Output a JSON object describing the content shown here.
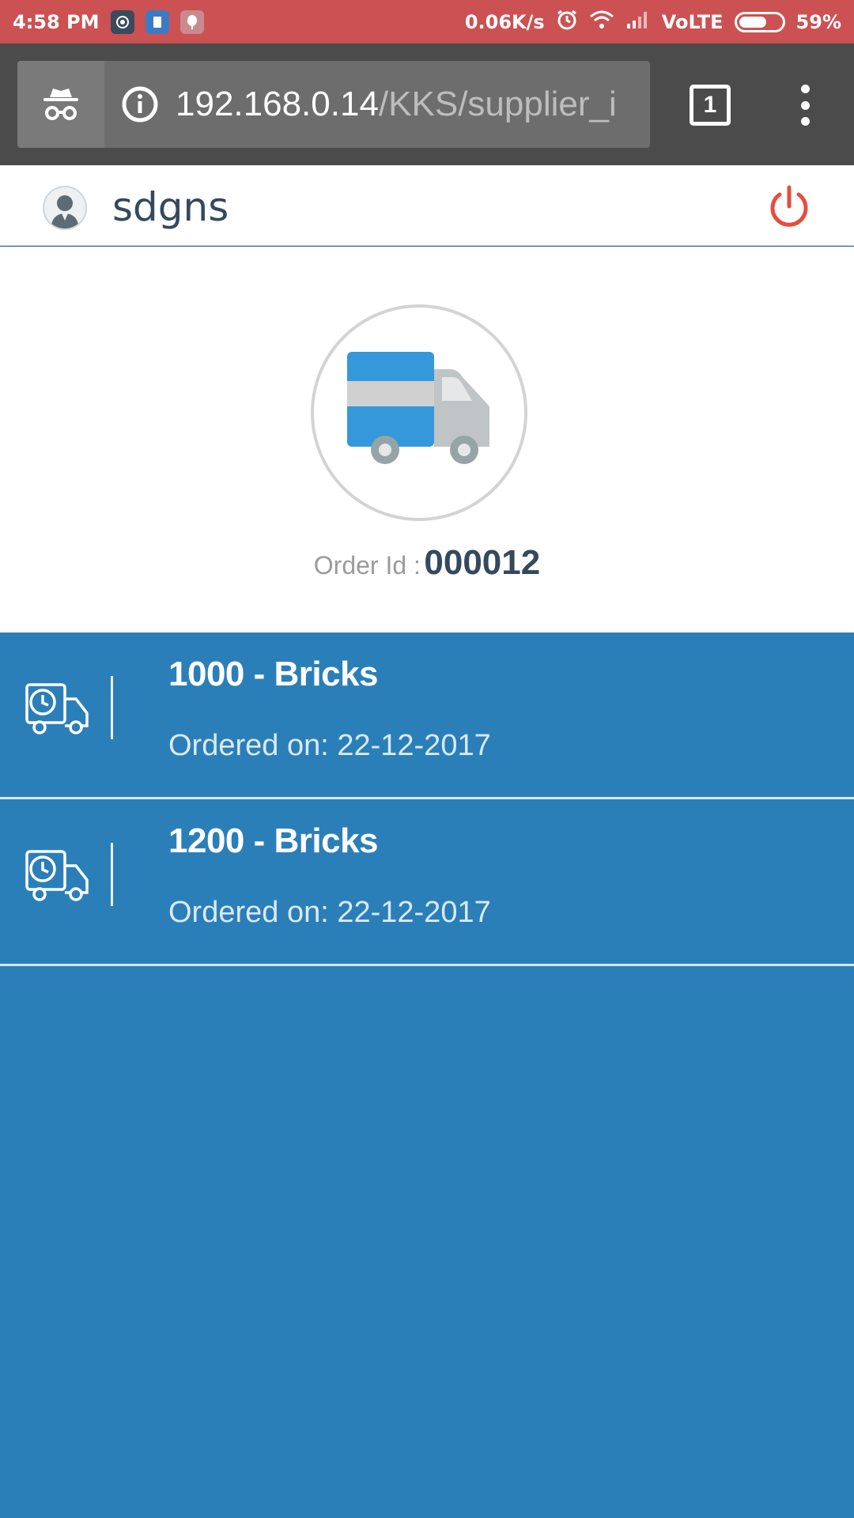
{
  "status_bar": {
    "time": "4:58 PM",
    "net_speed": "0.06K/s",
    "network": "VoLTE",
    "battery": "59%",
    "battery_level": 0.59,
    "icons": [
      "chrome-notification-icon",
      "app-notification-icon",
      "balloon-notification-icon",
      "alarm-icon",
      "wifi-icon",
      "signal-icon",
      "battery-icon"
    ]
  },
  "browser": {
    "url_host": "192.168.0.14",
    "url_path": "/KKS/supplier_i",
    "tab_count": "1",
    "icons": [
      "incognito-icon",
      "info-icon",
      "tabs-icon",
      "more-menu-icon"
    ]
  },
  "header": {
    "username": "sdgns",
    "icons": [
      "avatar-icon",
      "power-icon"
    ],
    "power_color": "#e74c3c"
  },
  "hero": {
    "order_id_label": "Order Id :",
    "order_id": "000012",
    "icon": "truck-icon"
  },
  "orders": [
    {
      "title": "1000 - Bricks",
      "date": "Ordered on: 22-12-2017",
      "icon": "delivery-truck-clock-icon"
    },
    {
      "title": "1200 - Bricks",
      "date": "Ordered on: 22-12-2017",
      "icon": "delivery-truck-clock-icon"
    }
  ],
  "colors": {
    "status_bar": "#cc5152",
    "toolbar": "#4b4b4b",
    "list_background": "#2b7fb8",
    "text_dark": "#34495e"
  }
}
